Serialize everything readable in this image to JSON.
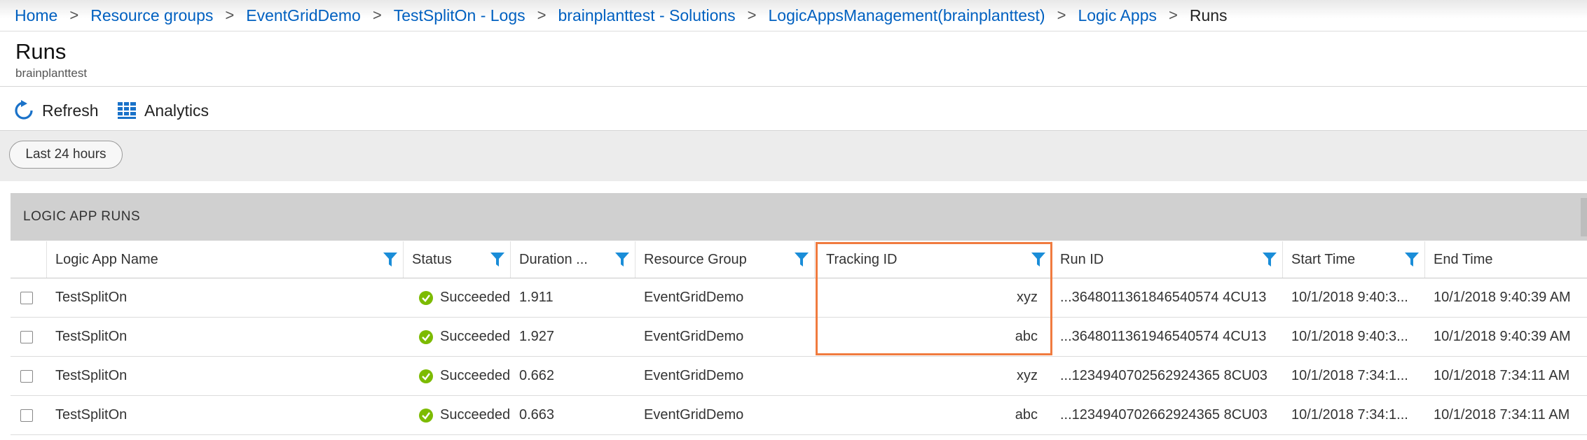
{
  "breadcrumb": [
    {
      "label": "Home"
    },
    {
      "label": "Resource groups"
    },
    {
      "label": "EventGridDemo"
    },
    {
      "label": "TestSplitOn - Logs"
    },
    {
      "label": "brainplanttest - Solutions"
    },
    {
      "label": "LogicAppsManagement(brainplanttest)"
    },
    {
      "label": "Logic Apps"
    },
    {
      "label": "Runs"
    }
  ],
  "page": {
    "title": "Runs",
    "subtitle": "brainplanttest"
  },
  "toolbar": {
    "refresh_label": "Refresh",
    "analytics_label": "Analytics"
  },
  "time_filter": {
    "label": "Last 24 hours"
  },
  "panel": {
    "title": "LOGIC APP RUNS"
  },
  "columns": [
    "Logic App Name",
    "Status",
    "Duration ...",
    "Resource Group",
    "Tracking ID",
    "Run ID",
    "Start Time",
    "End Time"
  ],
  "rows": [
    {
      "name": "TestSplitOn",
      "status": "Succeeded",
      "duration": "1.911",
      "group": "EventGridDemo",
      "tracking": "xyz",
      "run_id": "...3648011361846540574 4CU13",
      "start": "10/1/2018 9:40:3...",
      "end": "10/1/2018 9:40:39 AM"
    },
    {
      "name": "TestSplitOn",
      "status": "Succeeded",
      "duration": "1.927",
      "group": "EventGridDemo",
      "tracking": "abc",
      "run_id": "...3648011361946540574 4CU13",
      "start": "10/1/2018 9:40:3...",
      "end": "10/1/2018 9:40:39 AM"
    },
    {
      "name": "TestSplitOn",
      "status": "Succeeded",
      "duration": "0.662",
      "group": "EventGridDemo",
      "tracking": "xyz",
      "run_id": "...1234940702562924365 8CU03",
      "start": "10/1/2018 7:34:1...",
      "end": "10/1/2018 7:34:11 AM"
    },
    {
      "name": "TestSplitOn",
      "status": "Succeeded",
      "duration": "0.663",
      "group": "EventGridDemo",
      "tracking": "abc",
      "run_id": "...1234940702662924365 8CU03",
      "start": "10/1/2018 7:34:1...",
      "end": "10/1/2018 7:34:11 AM"
    }
  ],
  "colors": {
    "link": "#0060c0",
    "success": "#7cbb00",
    "filter_icon": "#1a8dd8",
    "highlight": "#f07b3f",
    "panel_header": "#d0d0d0"
  },
  "icons": {
    "refresh": "refresh-icon",
    "analytics": "grid-icon",
    "filter": "funnel-icon",
    "status": "check-circle-icon"
  }
}
